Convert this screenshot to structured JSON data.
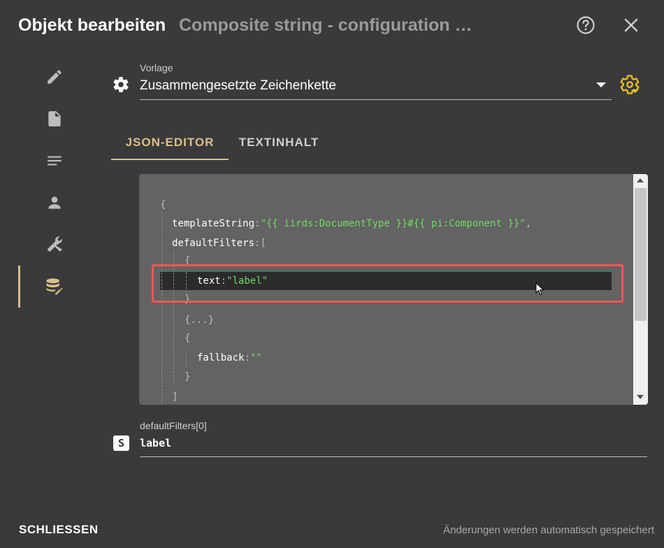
{
  "header": {
    "title": "Objekt bearbeiten",
    "subtitle": "Composite string - configuration o…",
    "help_icon": "help-circle-icon",
    "close_icon": "close-icon"
  },
  "sidebar": {
    "items": [
      {
        "icon": "pencil-icon"
      },
      {
        "icon": "document-icon"
      },
      {
        "icon": "text-lines-icon"
      },
      {
        "icon": "person-icon"
      },
      {
        "icon": "tools-icon"
      },
      {
        "icon": "database-edit-icon",
        "active": true
      }
    ]
  },
  "template": {
    "label": "Vorlage",
    "value": "Zusammengesetzte Zeichenkette",
    "action_icon": "gear-refresh-icon"
  },
  "tabs": [
    {
      "label": "JSON-EDITOR",
      "active": true
    },
    {
      "label": "TEXTINHALT",
      "active": false
    }
  ],
  "editor": {
    "open_brace": "{",
    "templateString_key": "templateString",
    "templateString_value": "\"{{ iirds:DocumentType }}#{{ pi:Component }}\"",
    "comma": ",",
    "defaultFilters_key": "defaultFilters",
    "open_bracket": "[",
    "obj1_open": "{",
    "text_key": "text",
    "text_value": "\"label\"",
    "obj1_close": "}",
    "obj2_collapsed": "{...}",
    "obj3_open": "{",
    "fallback_key": "fallback",
    "fallback_value": "\"\"",
    "obj3_close": "}",
    "close_bracket": "]",
    "colon": ":"
  },
  "path": {
    "label": "defaultFilters[0]",
    "type_badge": "S",
    "value": "label"
  },
  "footer": {
    "close_label": "SCHLIESSEN",
    "status": "Änderungen werden automatisch gespeichert"
  },
  "colors": {
    "accent": "#d9c08c",
    "highlight": "#e85a5a",
    "string": "#6ddb61",
    "background": "#3a3a3a"
  }
}
